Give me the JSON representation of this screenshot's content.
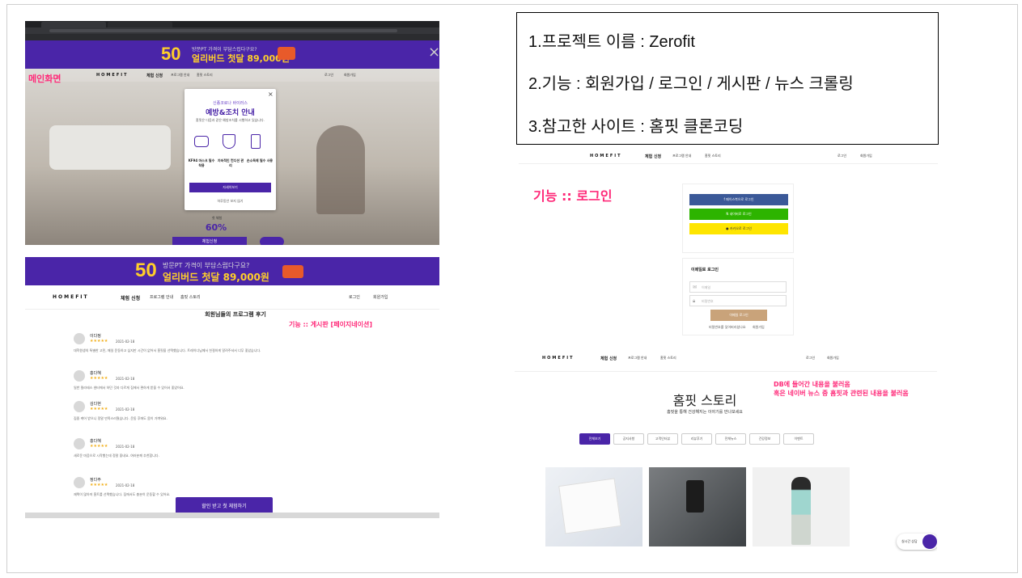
{
  "info": {
    "line1": "1.프로젝트 이름 : Zerofit",
    "line2": "2.기능 : 회원가입 / 로그인 / 게시판 / 뉴스 크롤링",
    "line3": "3.참고한 사이트 : 홈핏 클론코딩"
  },
  "labels": {
    "main": "메인화면",
    "login": "기능 :: 로그인",
    "board": "기능 :: 게시판 [페이지네이션]",
    "news_line1": "DB에 들어간 내용을 불러옴",
    "news_line2": "혹은 네이버 뉴스 중 홈핏과 관련된 내용을 불러옴"
  },
  "banner": {
    "big": "50",
    "small": "방문PT 가격이 부담스럽다구요?",
    "main": "얼리버드 첫달 89,000원"
  },
  "nav": {
    "logo": "HOMEFIT",
    "items": [
      "체험 신청",
      "프로그램 안내",
      "홈핏 스토리"
    ],
    "right": [
      "로그인",
      "회원가입"
    ]
  },
  "modal": {
    "eyebrow": "신종코로나 바이러스",
    "title": "예방&조치 안내",
    "desc": "홈핏은 다음과 같은 예방조치를 시행하고 있습니다.",
    "items": [
      "KF94 마스크 필수 착용",
      "지속적인 컨디션 관리",
      "손소독제 필수 사용"
    ],
    "button": "자세히보기",
    "hide": "하루동안 보지 않기"
  },
  "hero": {
    "discount_label": "첫 체험",
    "discount": "60%",
    "cta": "체험신청"
  },
  "board": {
    "heading": "회원님들의 프로그램 후기",
    "cta": "할인 받고 첫 체험하기",
    "reviews": [
      {
        "name": "이다정",
        "date": "2021-02-18",
        "text": "대학원생의 특별한 고민, 매일 운동하고 싶지만 시간이 없어서 홈핏을 선택했습니다. 트레이너님께서 친절하게 알려주셔서 너무 좋았습니다."
      },
      {
        "name": "홍다혜",
        "date": "2021-02-18",
        "text": "일반 필라테스 센터에서 하던 것과 다르게 집에서 편하게 받을 수 있어서 좋았어요."
      },
      {
        "name": "김다현",
        "date": "2021-02-18",
        "text": "집중 케어 받으니 정말 만족스러웠습니다. 운동 후에도 몸이 가벼워요."
      },
      {
        "name": "홍다혜",
        "date": "2021-02-18",
        "text": "새로운 마음으로 시작했는데 정말 좋네요. 여러분께 추천합니다."
      },
      {
        "name": "정다주",
        "date": "2021-02-18",
        "text": "재택이 많아져 홈트를 선택했습니다. 집에서도 충분히 운동할 수 있어요."
      }
    ]
  },
  "login": {
    "facebook": "페이스북으로 로그인",
    "naver": "네이버로 로그인",
    "kakao": "카카오로 로그인",
    "email_title": "이메일로 로그인",
    "email_placeholder": "이메일",
    "password_placeholder": "비밀번호",
    "submit": "이메일 로그인",
    "forgot": "비밀번호를 잊어버리셨나요",
    "signup": "회원가입"
  },
  "story": {
    "title": "홈핏 스토리",
    "subtitle": "홈핏을 통해 건강해지는 이야기를 만나보세요",
    "tabs": [
      "전체보기",
      "공지사항",
      "고객인터뷰",
      "리뷰후기",
      "전체뉴스",
      "건강정보",
      "이벤트"
    ],
    "chat": "실시간 상담"
  },
  "colors": {
    "purple": "#4a25a8",
    "pink": "#ff2a79",
    "facebook": "#3b5998",
    "naver": "#2db400",
    "kakao": "#fee500",
    "login_button": "#c9a37a"
  }
}
